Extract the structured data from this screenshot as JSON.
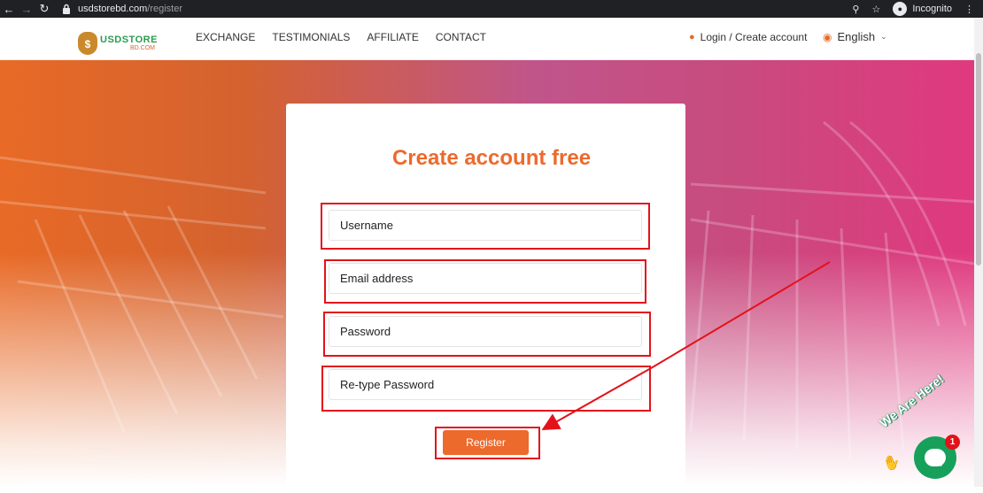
{
  "browser": {
    "host": "usdstorebd.com",
    "path": "/register",
    "mode_label": "Incognito"
  },
  "logo": {
    "line1": "USDSTORE",
    "line2": "BD.COM",
    "mark": "$"
  },
  "nav": {
    "items": [
      {
        "label": "EXCHANGE"
      },
      {
        "label": "TESTIMONIALS"
      },
      {
        "label": "AFFILIATE"
      },
      {
        "label": "CONTACT"
      }
    ],
    "login_label": "Login / Create account",
    "language": "English"
  },
  "form": {
    "title": "Create account free",
    "username_placeholder": "Username",
    "email_placeholder": "Email address",
    "password_placeholder": "Password",
    "retype_placeholder": "Re-type Password",
    "submit_label": "Register"
  },
  "chat": {
    "tagline": "We Are Here!",
    "badge_count": "1"
  },
  "colors": {
    "accent": "#ec6a2c",
    "annotation": "#e3121a",
    "chat": "#17a05a"
  }
}
